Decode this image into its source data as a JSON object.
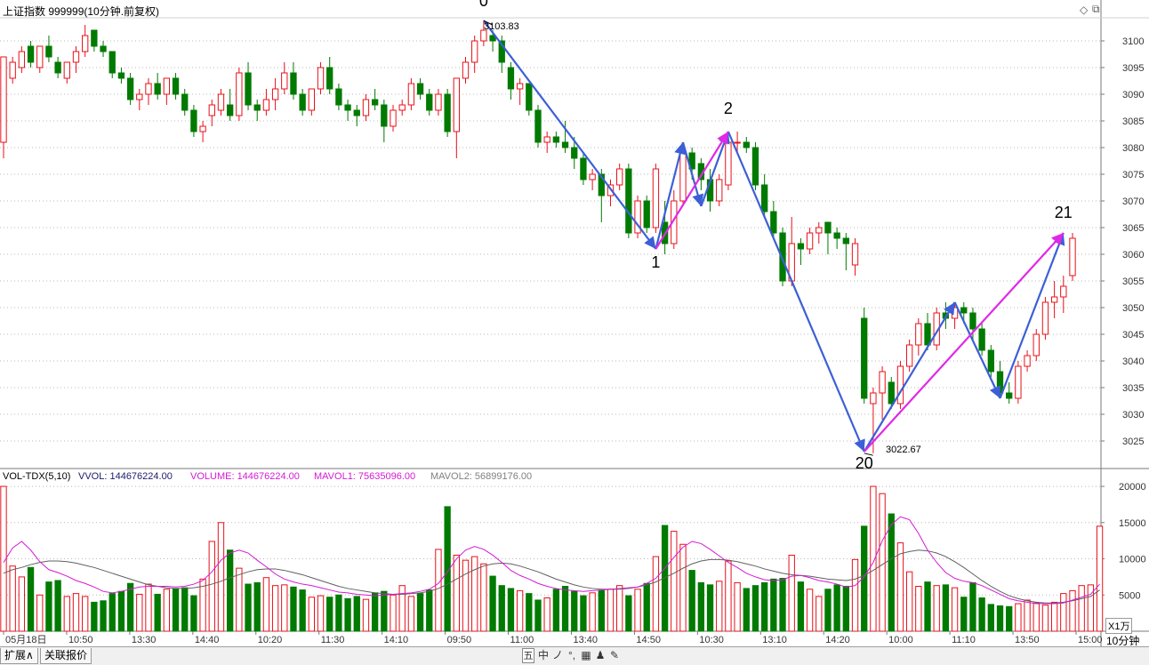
{
  "header": {
    "title": "上证指数 999999(10分钟.前复权)",
    "corner_icons": [
      "diamond-icon",
      "restore-icon"
    ]
  },
  "price_axis": {
    "ticks": [
      3100,
      3095,
      3090,
      3085,
      3080,
      3075,
      3070,
      3065,
      3060,
      3055,
      3050,
      3045,
      3040,
      3035,
      3030,
      3025
    ]
  },
  "volume_header": {
    "name": "VOL-TDX(5,10)",
    "vvol": "VVOL: 144676224.00",
    "volume": "VOLUME: 144676224.00",
    "mavol1": "MAVOL1: 75635096.00",
    "mavol2": "MAVOL2: 56899176.00"
  },
  "volume_axis": {
    "ticks": [
      20000,
      15000,
      10000,
      5000
    ],
    "unit_label": "X1万"
  },
  "time_axis": {
    "labels": [
      "05月18日",
      "10:50",
      "13:30",
      "14:40",
      "10:20",
      "11:30",
      "14:10",
      "09:50",
      "11:00",
      "13:40",
      "14:50",
      "10:30",
      "13:10",
      "14:20",
      "10:00",
      "11:10",
      "13:50",
      "15:00"
    ],
    "period_label": "10分钟"
  },
  "annotations": {
    "high_label": "3103.83",
    "low_label": "3022.67",
    "wave_numbers": [
      "0",
      "1",
      "2",
      "20",
      "21"
    ]
  },
  "bottom_bar": {
    "tab_extend": "扩展∧",
    "tab_quote": "关联报价",
    "tools": [
      "五",
      "中",
      "ノ",
      "°,",
      "▦",
      "♟",
      "✎"
    ]
  },
  "colors": {
    "up": "#e8101a",
    "down": "#007a00",
    "wave_blue": "#3c5fd6",
    "wave_magenta": "#e028e6",
    "mavol1": "#d41ad4",
    "mavol2": "#606060",
    "grid": "#b8b8b8",
    "axis": "#7a7a7a"
  },
  "chart_data": {
    "type": "candlestick",
    "title": "上证指数 999999(10分钟.前复权)",
    "ylim": [
      3020,
      3104
    ],
    "volume_ylim": [
      0,
      20500
    ],
    "candles": [
      {
        "o": 3081,
        "h": 3085,
        "l": 3078,
        "c": 3097,
        "d": "up"
      },
      {
        "o": 3093,
        "h": 3097,
        "l": 3092,
        "c": 3096,
        "d": "up"
      },
      {
        "o": 3095,
        "h": 3099,
        "l": 3094,
        "c": 3098,
        "d": "up"
      },
      {
        "o": 3099,
        "h": 3100,
        "l": 3095,
        "c": 3096,
        "d": "down"
      },
      {
        "o": 3095,
        "h": 3099,
        "l": 3094,
        "c": 3099,
        "d": "up"
      },
      {
        "o": 3099,
        "h": 3101,
        "l": 3096,
        "c": 3097,
        "d": "down"
      },
      {
        "o": 3096,
        "h": 3097,
        "l": 3093,
        "c": 3094,
        "d": "down"
      },
      {
        "o": 3093,
        "h": 3096,
        "l": 3092,
        "c": 3096,
        "d": "up"
      },
      {
        "o": 3096,
        "h": 3099,
        "l": 3094,
        "c": 3098,
        "d": "up"
      },
      {
        "o": 3098,
        "h": 3103,
        "l": 3097,
        "c": 3101,
        "d": "up"
      },
      {
        "o": 3102,
        "h": 3102,
        "l": 3098,
        "c": 3099,
        "d": "down"
      },
      {
        "o": 3099,
        "h": 3100,
        "l": 3097,
        "c": 3098,
        "d": "down"
      },
      {
        "o": 3098,
        "h": 3098,
        "l": 3093,
        "c": 3094,
        "d": "down"
      },
      {
        "o": 3094,
        "h": 3095,
        "l": 3092,
        "c": 3093,
        "d": "down"
      },
      {
        "o": 3093,
        "h": 3094,
        "l": 3088,
        "c": 3089,
        "d": "down"
      },
      {
        "o": 3089,
        "h": 3091,
        "l": 3087,
        "c": 3090,
        "d": "up"
      },
      {
        "o": 3090,
        "h": 3093,
        "l": 3088,
        "c": 3092,
        "d": "up"
      },
      {
        "o": 3092,
        "h": 3094,
        "l": 3089,
        "c": 3090,
        "d": "down"
      },
      {
        "o": 3090,
        "h": 3093,
        "l": 3088,
        "c": 3093,
        "d": "up"
      },
      {
        "o": 3093,
        "h": 3094,
        "l": 3089,
        "c": 3090,
        "d": "down"
      },
      {
        "o": 3090,
        "h": 3091,
        "l": 3086,
        "c": 3087,
        "d": "down"
      },
      {
        "o": 3087,
        "h": 3088,
        "l": 3082,
        "c": 3083,
        "d": "down"
      },
      {
        "o": 3083,
        "h": 3085,
        "l": 3081,
        "c": 3084,
        "d": "up"
      },
      {
        "o": 3086,
        "h": 3089,
        "l": 3084,
        "c": 3088,
        "d": "up"
      },
      {
        "o": 3087,
        "h": 3091,
        "l": 3086,
        "c": 3090,
        "d": "up"
      },
      {
        "o": 3088,
        "h": 3091,
        "l": 3085,
        "c": 3086,
        "d": "down"
      },
      {
        "o": 3086,
        "h": 3095,
        "l": 3085,
        "c": 3094,
        "d": "up"
      },
      {
        "o": 3094,
        "h": 3096,
        "l": 3087,
        "c": 3088,
        "d": "down"
      },
      {
        "o": 3088,
        "h": 3089,
        "l": 3085,
        "c": 3087,
        "d": "down"
      },
      {
        "o": 3087,
        "h": 3091,
        "l": 3086,
        "c": 3089,
        "d": "up"
      },
      {
        "o": 3089,
        "h": 3093,
        "l": 3087,
        "c": 3091,
        "d": "up"
      },
      {
        "o": 3091,
        "h": 3096,
        "l": 3090,
        "c": 3094,
        "d": "up"
      },
      {
        "o": 3094,
        "h": 3096,
        "l": 3089,
        "c": 3090,
        "d": "down"
      },
      {
        "o": 3090,
        "h": 3091,
        "l": 3086,
        "c": 3087,
        "d": "down"
      },
      {
        "o": 3087,
        "h": 3090,
        "l": 3086,
        "c": 3091,
        "d": "up"
      },
      {
        "o": 3091,
        "h": 3096,
        "l": 3090,
        "c": 3095,
        "d": "up"
      },
      {
        "o": 3095,
        "h": 3097,
        "l": 3090,
        "c": 3091,
        "d": "down"
      },
      {
        "o": 3091,
        "h": 3092,
        "l": 3087,
        "c": 3088,
        "d": "down"
      },
      {
        "o": 3088,
        "h": 3089,
        "l": 3085,
        "c": 3087,
        "d": "down"
      },
      {
        "o": 3087,
        "h": 3088,
        "l": 3084,
        "c": 3086,
        "d": "down"
      },
      {
        "o": 3086,
        "h": 3090,
        "l": 3085,
        "c": 3089,
        "d": "up"
      },
      {
        "o": 3089,
        "h": 3091,
        "l": 3087,
        "c": 3088,
        "d": "down"
      },
      {
        "o": 3088,
        "h": 3089,
        "l": 3081,
        "c": 3084,
        "d": "down"
      },
      {
        "o": 3084,
        "h": 3088,
        "l": 3083,
        "c": 3087,
        "d": "up"
      },
      {
        "o": 3087,
        "h": 3089,
        "l": 3086,
        "c": 3088,
        "d": "up"
      },
      {
        "o": 3088,
        "h": 3093,
        "l": 3087,
        "c": 3092,
        "d": "up"
      },
      {
        "o": 3092,
        "h": 3093,
        "l": 3089,
        "c": 3090,
        "d": "down"
      },
      {
        "o": 3090,
        "h": 3091,
        "l": 3086,
        "c": 3087,
        "d": "down"
      },
      {
        "o": 3087,
        "h": 3091,
        "l": 3086,
        "c": 3090,
        "d": "up"
      },
      {
        "o": 3090,
        "h": 3091,
        "l": 3082,
        "c": 3083,
        "d": "down"
      },
      {
        "o": 3083,
        "h": 3089,
        "l": 3078,
        "c": 3093,
        "d": "up"
      },
      {
        "o": 3093,
        "h": 3097,
        "l": 3092,
        "c": 3096,
        "d": "up"
      },
      {
        "o": 3096,
        "h": 3101,
        "l": 3094,
        "c": 3100,
        "d": "up"
      },
      {
        "o": 3100,
        "h": 3103.8,
        "l": 3099,
        "c": 3102,
        "d": "up"
      },
      {
        "o": 3101,
        "h": 3102,
        "l": 3098,
        "c": 3100,
        "d": "down"
      },
      {
        "o": 3100,
        "h": 3101,
        "l": 3094,
        "c": 3096,
        "d": "down"
      },
      {
        "o": 3095,
        "h": 3096,
        "l": 3089,
        "c": 3091,
        "d": "down"
      },
      {
        "o": 3091,
        "h": 3093,
        "l": 3088,
        "c": 3092,
        "d": "up"
      },
      {
        "o": 3092,
        "h": 3092,
        "l": 3086,
        "c": 3087,
        "d": "down"
      },
      {
        "o": 3087,
        "h": 3088,
        "l": 3080,
        "c": 3081,
        "d": "down"
      },
      {
        "o": 3081,
        "h": 3083,
        "l": 3079,
        "c": 3082,
        "d": "up"
      },
      {
        "o": 3082,
        "h": 3083,
        "l": 3080,
        "c": 3081,
        "d": "down"
      },
      {
        "o": 3081,
        "h": 3085,
        "l": 3079,
        "c": 3080,
        "d": "down"
      },
      {
        "o": 3080,
        "h": 3082,
        "l": 3076,
        "c": 3078,
        "d": "down"
      },
      {
        "o": 3078,
        "h": 3079,
        "l": 3073,
        "c": 3074,
        "d": "down"
      },
      {
        "o": 3074,
        "h": 3076,
        "l": 3072,
        "c": 3075,
        "d": "up"
      },
      {
        "o": 3075,
        "h": 3076,
        "l": 3066,
        "c": 3071,
        "d": "down"
      },
      {
        "o": 3071,
        "h": 3074,
        "l": 3069,
        "c": 3073,
        "d": "up"
      },
      {
        "o": 3073,
        "h": 3077,
        "l": 3072,
        "c": 3076,
        "d": "up"
      },
      {
        "o": 3076,
        "h": 3077,
        "l": 3063,
        "c": 3064,
        "d": "down"
      },
      {
        "o": 3064,
        "h": 3071,
        "l": 3063,
        "c": 3070,
        "d": "up"
      },
      {
        "o": 3070,
        "h": 3071,
        "l": 3064,
        "c": 3065,
        "d": "down"
      },
      {
        "o": 3065,
        "h": 3077,
        "l": 3064,
        "c": 3076,
        "d": "up"
      },
      {
        "o": 3066,
        "h": 3070,
        "l": 3060,
        "c": 3062,
        "d": "down"
      },
      {
        "o": 3062,
        "h": 3072,
        "l": 3061,
        "c": 3070,
        "d": "up"
      },
      {
        "o": 3070,
        "h": 3080,
        "l": 3069,
        "c": 3079,
        "d": "up"
      },
      {
        "o": 3079,
        "h": 3080,
        "l": 3074,
        "c": 3076,
        "d": "down"
      },
      {
        "o": 3077,
        "h": 3078,
        "l": 3072,
        "c": 3074,
        "d": "down"
      },
      {
        "o": 3074,
        "h": 3076,
        "l": 3068,
        "c": 3070,
        "d": "down"
      },
      {
        "o": 3070,
        "h": 3075,
        "l": 3069,
        "c": 3074,
        "d": "up"
      },
      {
        "o": 3073,
        "h": 3082,
        "l": 3072,
        "c": 3081,
        "d": "up"
      },
      {
        "o": 3081,
        "h": 3083,
        "l": 3079,
        "c": 3081,
        "d": "up"
      },
      {
        "o": 3081,
        "h": 3082,
        "l": 3079,
        "c": 3080,
        "d": "down"
      },
      {
        "o": 3080,
        "h": 3081,
        "l": 3072,
        "c": 3073,
        "d": "down"
      },
      {
        "o": 3073,
        "h": 3075,
        "l": 3067,
        "c": 3068,
        "d": "down"
      },
      {
        "o": 3068,
        "h": 3070,
        "l": 3063,
        "c": 3064,
        "d": "down"
      },
      {
        "o": 3064,
        "h": 3065,
        "l": 3054,
        "c": 3055,
        "d": "down"
      },
      {
        "o": 3055,
        "h": 3067,
        "l": 3054,
        "c": 3062,
        "d": "up"
      },
      {
        "o": 3062,
        "h": 3063,
        "l": 3058,
        "c": 3061,
        "d": "down"
      },
      {
        "o": 3061,
        "h": 3065,
        "l": 3060,
        "c": 3064,
        "d": "up"
      },
      {
        "o": 3064,
        "h": 3066,
        "l": 3062,
        "c": 3065,
        "d": "up"
      },
      {
        "o": 3066,
        "h": 3066,
        "l": 3060,
        "c": 3064,
        "d": "down"
      },
      {
        "o": 3064,
        "h": 3065,
        "l": 3061,
        "c": 3063,
        "d": "down"
      },
      {
        "o": 3063,
        "h": 3064,
        "l": 3057,
        "c": 3062,
        "d": "down"
      },
      {
        "o": 3058,
        "h": 3063,
        "l": 3056,
        "c": 3062,
        "d": "up"
      },
      {
        "o": 3048,
        "h": 3050,
        "l": 3032,
        "c": 3033,
        "d": "down"
      },
      {
        "o": 3032,
        "h": 3035,
        "l": 3022.7,
        "c": 3034,
        "d": "up"
      },
      {
        "o": 3034,
        "h": 3039,
        "l": 3029,
        "c": 3038,
        "d": "up"
      },
      {
        "o": 3036,
        "h": 3037,
        "l": 3031,
        "c": 3032,
        "d": "down"
      },
      {
        "o": 3032,
        "h": 3040,
        "l": 3031,
        "c": 3039,
        "d": "up"
      },
      {
        "o": 3039,
        "h": 3044,
        "l": 3038,
        "c": 3043,
        "d": "up"
      },
      {
        "o": 3043,
        "h": 3048,
        "l": 3041,
        "c": 3047,
        "d": "up"
      },
      {
        "o": 3047,
        "h": 3049,
        "l": 3042,
        "c": 3043,
        "d": "down"
      },
      {
        "o": 3043,
        "h": 3050,
        "l": 3042,
        "c": 3049,
        "d": "up"
      },
      {
        "o": 3049,
        "h": 3051,
        "l": 3046,
        "c": 3048,
        "d": "down"
      },
      {
        "o": 3048,
        "h": 3051,
        "l": 3046,
        "c": 3050,
        "d": "up"
      },
      {
        "o": 3050,
        "h": 3051,
        "l": 3047,
        "c": 3049,
        "d": "down"
      },
      {
        "o": 3049,
        "h": 3050,
        "l": 3044,
        "c": 3046,
        "d": "down"
      },
      {
        "o": 3046,
        "h": 3047,
        "l": 3041,
        "c": 3042,
        "d": "down"
      },
      {
        "o": 3042,
        "h": 3043,
        "l": 3037,
        "c": 3038,
        "d": "down"
      },
      {
        "o": 3038,
        "h": 3040,
        "l": 3033,
        "c": 3034,
        "d": "down"
      },
      {
        "o": 3034,
        "h": 3036,
        "l": 3032,
        "c": 3033,
        "d": "down"
      },
      {
        "o": 3033,
        "h": 3040,
        "l": 3032,
        "c": 3039,
        "d": "up"
      },
      {
        "o": 3039,
        "h": 3042,
        "l": 3038,
        "c": 3041,
        "d": "up"
      },
      {
        "o": 3041,
        "h": 3046,
        "l": 3040,
        "c": 3045,
        "d": "up"
      },
      {
        "o": 3045,
        "h": 3052,
        "l": 3044,
        "c": 3051,
        "d": "up"
      },
      {
        "o": 3051,
        "h": 3055,
        "l": 3048,
        "c": 3052,
        "d": "up"
      },
      {
        "o": 3052,
        "h": 3056,
        "l": 3049,
        "c": 3054,
        "d": "up"
      },
      {
        "o": 3056,
        "h": 3064,
        "l": 3055,
        "c": 3063,
        "d": "up"
      }
    ],
    "volume": [
      20000,
      9000,
      7500,
      8800,
      5000,
      6800,
      7000,
      4800,
      5200,
      4800,
      4000,
      4200,
      5200,
      5500,
      6600,
      5100,
      6500,
      5100,
      5800,
      5900,
      6000,
      4900,
      7200,
      12400,
      15000,
      11200,
      8700,
      6500,
      6700,
      7400,
      6300,
      6400,
      6100,
      5700,
      4700,
      4900,
      4700,
      5000,
      4500,
      4800,
      4400,
      5300,
      5500,
      5000,
      6300,
      4800,
      5200,
      5700,
      11300,
      17200,
      10500,
      9800,
      10300,
      9300,
      7600,
      6300,
      5900,
      5600,
      5200,
      4300,
      4600,
      5800,
      6200,
      5500,
      4900,
      5300,
      5600,
      5800,
      6300,
      4900,
      5800,
      6600,
      10300,
      14600,
      13800,
      12000,
      8400,
      6700,
      6400,
      6900,
      9700,
      6700,
      5900,
      6300,
      6700,
      7200,
      7300,
      10500,
      6800,
      5800,
      4800,
      5800,
      6400,
      6200,
      9900,
      14500,
      20000,
      19000,
      16200,
      12200,
      8200,
      6200,
      6800,
      6300,
      6400,
      6000,
      4700,
      6700,
      4600,
      3700,
      3500,
      3400,
      3800,
      4300,
      3900,
      3600,
      4000,
      5200,
      5600,
      6300,
      6400,
      14500
    ],
    "mavol1": [
      9500,
      11500,
      12400,
      11200,
      9600,
      8500,
      8100,
      7600,
      7000,
      6600,
      6100,
      5500,
      5300,
      5500,
      5800,
      6100,
      6200,
      6200,
      6200,
      6100,
      6200,
      6500,
      7000,
      8200,
      9800,
      10800,
      11200,
      10800,
      9800,
      8900,
      7900,
      7200,
      6800,
      6500,
      6300,
      6000,
      5700,
      5400,
      5300,
      5100,
      5000,
      4900,
      5000,
      5100,
      5200,
      5300,
      5500,
      5800,
      6600,
      8200,
      10000,
      11200,
      11700,
      11300,
      10500,
      9500,
      8400,
      7700,
      7200,
      6600,
      6200,
      5900,
      5700,
      5600,
      5500,
      5600,
      5700,
      5800,
      5900,
      6000,
      6100,
      6600,
      7300,
      8700,
      10200,
      11600,
      12400,
      12100,
      11300,
      10400,
      9500,
      8800,
      8000,
      7500,
      7100,
      7000,
      7100,
      7600,
      7700,
      7400,
      7000,
      6800,
      6500,
      6100,
      6300,
      7500,
      9500,
      12500,
      14700,
      15800,
      15400,
      13500,
      11200,
      9500,
      8100,
      7300,
      6900,
      6700,
      6300,
      5700,
      5100,
      4500,
      4200,
      4000,
      3800,
      3800,
      3800,
      3900,
      4300,
      4700,
      5100,
      6500
    ],
    "mavol2": [
      8000,
      8500,
      8800,
      9200,
      9500,
      9700,
      9700,
      9600,
      9400,
      9100,
      8800,
      8400,
      8000,
      7600,
      7200,
      6800,
      6400,
      6200,
      6000,
      5900,
      5900,
      6000,
      6200,
      6500,
      6900,
      7400,
      7800,
      8200,
      8500,
      8600,
      8600,
      8400,
      8100,
      7800,
      7400,
      7000,
      6600,
      6200,
      5900,
      5700,
      5500,
      5300,
      5200,
      5100,
      5100,
      5200,
      5300,
      5500,
      5900,
      6500,
      7200,
      7900,
      8500,
      9000,
      9300,
      9400,
      9300,
      9000,
      8600,
      8200,
      7700,
      7200,
      6800,
      6400,
      6100,
      5900,
      5800,
      5800,
      5800,
      5900,
      6100,
      6400,
      6800,
      7400,
      8000,
      8700,
      9300,
      9700,
      9900,
      9900,
      9800,
      9600,
      9300,
      9000,
      8600,
      8300,
      8000,
      7800,
      7700,
      7600,
      7400,
      7200,
      7100,
      7000,
      7200,
      7700,
      8400,
      9200,
      10000,
      10700,
      11000,
      11200,
      11100,
      10800,
      10300,
      9600,
      8800,
      7900,
      7000,
      6200,
      5500,
      4900,
      4500,
      4200,
      4000,
      3900,
      3900,
      4000,
      4200,
      4500,
      4800,
      5700
    ]
  }
}
